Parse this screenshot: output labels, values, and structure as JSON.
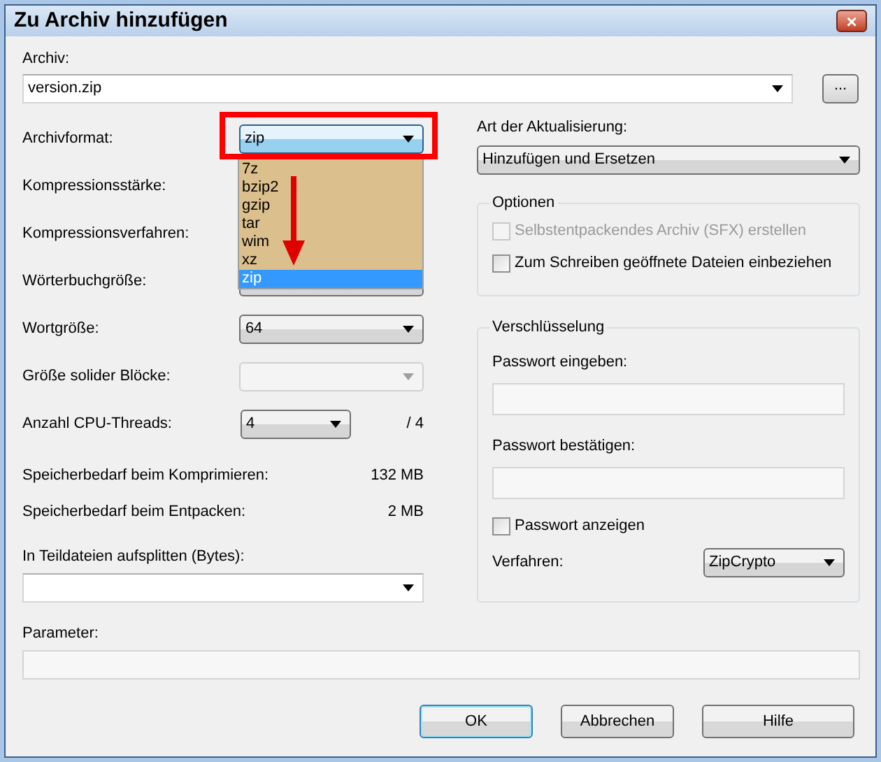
{
  "window": {
    "title": "Zu Archiv hinzufügen",
    "close": "×"
  },
  "archive": {
    "label": "Archiv:",
    "value": "version.zip",
    "browse": "..."
  },
  "format": {
    "label": "Archivformat:",
    "value": "zip",
    "expanded": true,
    "options": [
      {
        "label": "7z",
        "selected": false
      },
      {
        "label": "bzip2",
        "selected": false
      },
      {
        "label": "gzip",
        "selected": false
      },
      {
        "label": "tar",
        "selected": false
      },
      {
        "label": "wim",
        "selected": false
      },
      {
        "label": "xz",
        "selected": false
      },
      {
        "label": "zip",
        "selected": true
      }
    ]
  },
  "settings": [
    {
      "kind": "covered",
      "label": "Kompressionsstärke:"
    },
    {
      "kind": "covered",
      "label": "Kompressionsverfahren:"
    },
    {
      "kind": "combo",
      "label": "Wörterbuchgröße:",
      "disabled": false
    },
    {
      "kind": "combo",
      "label": "Wortgröße:",
      "value": "64",
      "disabled": false
    },
    {
      "kind": "combo",
      "label": "Größe solider Blöcke:",
      "disabled": true
    },
    {
      "kind": "threads",
      "label": "Anzahl CPU-Threads:",
      "value": "4",
      "disabled": false,
      "suffix": "/ 4"
    }
  ],
  "memory": [
    {
      "label": "Speicherbedarf beim Komprimieren:",
      "value": "132 MB"
    },
    {
      "label": "Speicherbedarf beim Entpacken:",
      "value": "2 MB"
    }
  ],
  "split": {
    "label": "In Teildateien aufsplitten (Bytes):"
  },
  "update": {
    "label": "Art der Aktualisierung:",
    "value": "Hinzufügen und Ersetzen"
  },
  "options": {
    "title": "Optionen",
    "items": [
      {
        "label": "Selbstentpackendes Archiv (SFX) erstellen",
        "checked": false,
        "disabled": true
      },
      {
        "label": "Zum Schreiben geöffnete Dateien einbeziehen",
        "checked": false,
        "disabled": false
      }
    ]
  },
  "encryption": {
    "title": "Verschlüsselung",
    "password_label": "Passwort eingeben:",
    "confirm_label": "Passwort bestätigen:",
    "show_password": {
      "label": "Passwort anzeigen",
      "checked": false
    },
    "method_label": "Verfahren:",
    "method": "ZipCrypto"
  },
  "parameter": {
    "label": "Parameter:"
  },
  "buttons": [
    {
      "label": "OK",
      "default": true
    },
    {
      "label": "Abbrechen",
      "default": false
    },
    {
      "label": "Hilfe",
      "default": false
    }
  ]
}
